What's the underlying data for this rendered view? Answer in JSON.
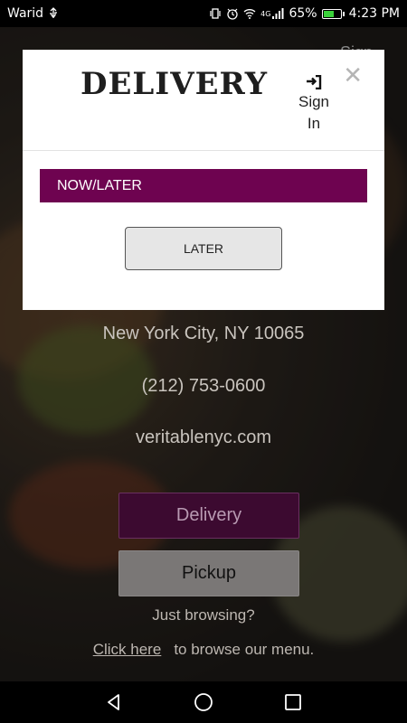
{
  "status_bar": {
    "carrier": "Warid",
    "battery_percent": "65%",
    "time": "4:23 PM",
    "network": "4G",
    "battery_color": "#3ad13a"
  },
  "background": {
    "signin_text": "Sign",
    "address_line2": "New York City, NY 10065",
    "phone": "(212) 753-0600",
    "website": "veritablenyc.com",
    "delivery_button": "Delivery",
    "pickup_button": "Pickup",
    "just_browsing": "Just browsing?",
    "click_here": "Click here",
    "browse_menu": "to browse our menu."
  },
  "modal": {
    "title": "DELIVERY",
    "signin_word1": "Sign",
    "signin_word2": "In",
    "close_symbol": "✕",
    "section_label": "NOW/LATER",
    "later_button": "LATER",
    "accent_color": "#6e0350"
  },
  "nav_bar": {
    "back_icon": "back-triangle-icon",
    "home_icon": "home-circle-icon",
    "recents_icon": "recents-square-icon"
  }
}
